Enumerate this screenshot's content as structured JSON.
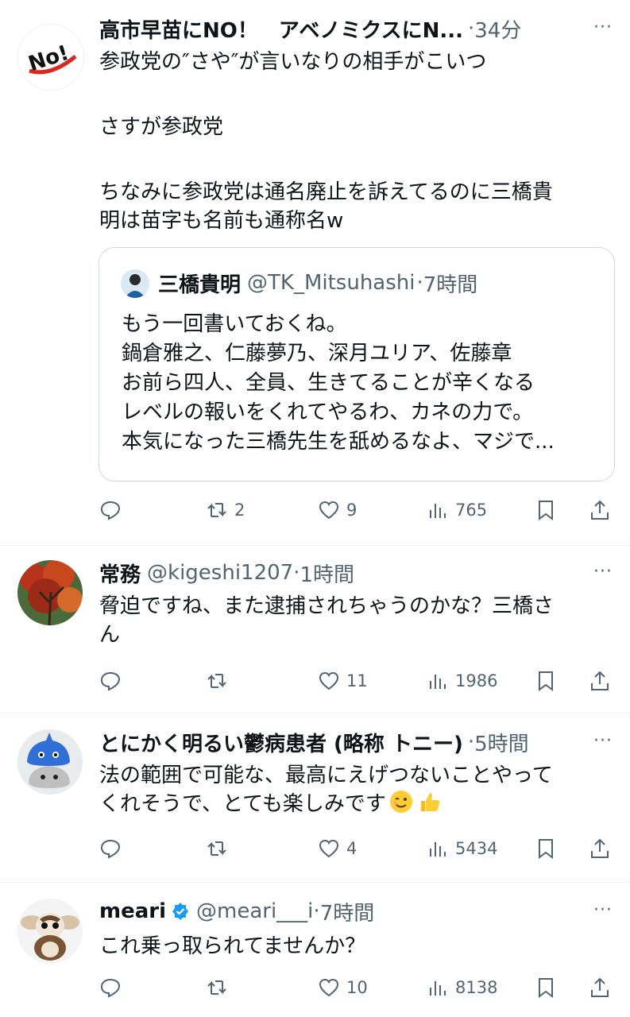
{
  "posts": [
    {
      "name": "高市早苗にNO！　アベノミクスにN...",
      "handle": "",
      "dot": "·",
      "time": "34分",
      "lines": [
        "参政党の″さや″が言いなりの相手がこいつ",
        "",
        "さすが参政党",
        "",
        "ちなみに参政党は通名廃止を訴えてるのに三橋貴",
        "明は苗字も名前も通称名w"
      ],
      "avatar_text": "No!",
      "quote": {
        "name": "三橋貴明",
        "handle": "@TK_Mitsuhashi",
        "dot": "·",
        "time": "7時間",
        "lines": [
          "もう一回書いておくね。",
          "鍋倉雅之、仁藤夢乃、深月ユリア、佐藤章",
          "お前ら四人、全員、生きてることが辛くなる",
          "レベルの報いをくれてやるわ、カネの力で。",
          "本気になった三橋先生を舐めるなよ、マジで..."
        ]
      },
      "reply_count": "",
      "retweet_count": "2",
      "like_count": "9",
      "view_count": "765"
    },
    {
      "name": "常務",
      "handle": "@kigeshi1207",
      "dot": "·",
      "time": "1時間",
      "lines": [
        "脅迫ですね、また逮捕されちゃうのかな？三橋さ",
        "ん"
      ],
      "reply_count": "",
      "retweet_count": "",
      "like_count": "11",
      "view_count": "1986"
    },
    {
      "name": "とにかく明るい鬱病患者 (略称 トニー)",
      "handle": "",
      "dot": "·",
      "time": "5時間",
      "lines": [
        "法の範囲で可能な、最高にえげつないことやって",
        "くれそうで、とても楽しみです"
      ],
      "emoji": [
        "winking-face-emoji",
        "thumbs-up-emoji"
      ],
      "reply_count": "",
      "retweet_count": "",
      "like_count": "4",
      "view_count": "5434"
    },
    {
      "name": "meari",
      "handle": "@meari___i",
      "dot": "·",
      "time": "7時間",
      "verified": true,
      "lines": [
        "これ乗っ取られてませんか？"
      ],
      "reply_count": "",
      "retweet_count": "",
      "like_count": "10",
      "view_count": "8138"
    }
  ],
  "more_label": "···",
  "icons": [
    "reply-icon",
    "retweet-icon",
    "like-icon",
    "views-icon",
    "bookmark-icon",
    "share-icon"
  ],
  "colors": {
    "text": "#0f1419",
    "secondary": "#536471",
    "border": "#cfd9de",
    "verified": "#1d9bf0"
  }
}
